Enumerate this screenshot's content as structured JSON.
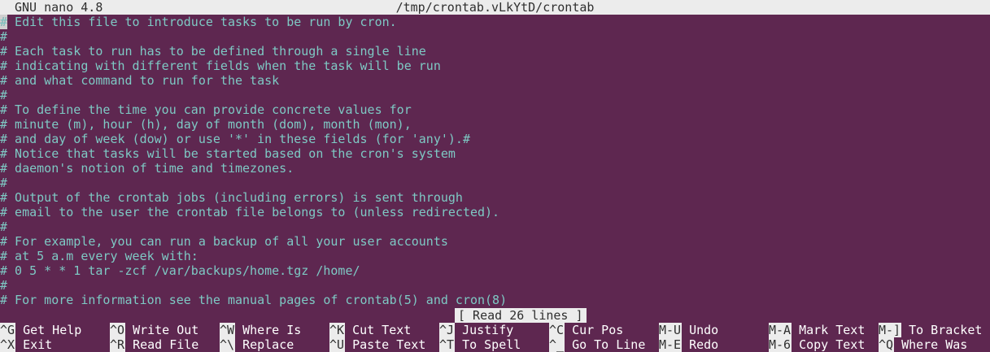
{
  "title_bar": {
    "app": "GNU nano 4.8",
    "file": "/tmp/crontab.vLkYtD/crontab"
  },
  "editor": {
    "cursor_char": "#",
    "lines": [
      "# Edit this file to introduce tasks to be run by cron.",
      "#",
      "# Each task to run has to be defined through a single line",
      "# indicating with different fields when the task will be run",
      "# and what command to run for the task",
      "#",
      "# To define the time you can provide concrete values for",
      "# minute (m), hour (h), day of month (dom), month (mon),",
      "# and day of week (dow) or use '*' in these fields (for 'any').#",
      "# Notice that tasks will be started based on the cron's system",
      "# daemon's notion of time and timezones.",
      "#",
      "# Output of the crontab jobs (including errors) is sent through",
      "# email to the user the crontab file belongs to (unless redirected).",
      "#",
      "# For example, you can run a backup of all your user accounts",
      "# at 5 a.m every week with:",
      "# 0 5 * * 1 tar -zcf /var/backups/home.tgz /home/",
      "#",
      "# For more information see the manual pages of crontab(5) and cron(8)"
    ]
  },
  "status": "[ Read 26 lines ]",
  "shortcuts": {
    "row1": [
      {
        "key": "^G",
        "label": "Get Help"
      },
      {
        "key": "^O",
        "label": "Write Out"
      },
      {
        "key": "^W",
        "label": "Where Is"
      },
      {
        "key": "^K",
        "label": "Cut Text"
      },
      {
        "key": "^J",
        "label": "Justify"
      },
      {
        "key": "^C",
        "label": "Cur Pos"
      },
      {
        "key": "M-U",
        "label": "Undo"
      },
      {
        "key": "M-A",
        "label": "Mark Text"
      },
      {
        "key": "M-]",
        "label": "To Bracket"
      }
    ],
    "row2": [
      {
        "key": "^X",
        "label": "Exit"
      },
      {
        "key": "^R",
        "label": "Read File"
      },
      {
        "key": "^\\",
        "label": "Replace"
      },
      {
        "key": "^U",
        "label": "Paste Text"
      },
      {
        "key": "^T",
        "label": "To Spell"
      },
      {
        "key": "^_",
        "label": "Go To Line"
      },
      {
        "key": "M-E",
        "label": "Redo"
      },
      {
        "key": "M-6",
        "label": "Copy Text"
      },
      {
        "key": "^Q",
        "label": "Where Was"
      }
    ]
  },
  "colors": {
    "background": "#5e2750",
    "text": "#7ec9c4",
    "bar": "#ececec"
  }
}
